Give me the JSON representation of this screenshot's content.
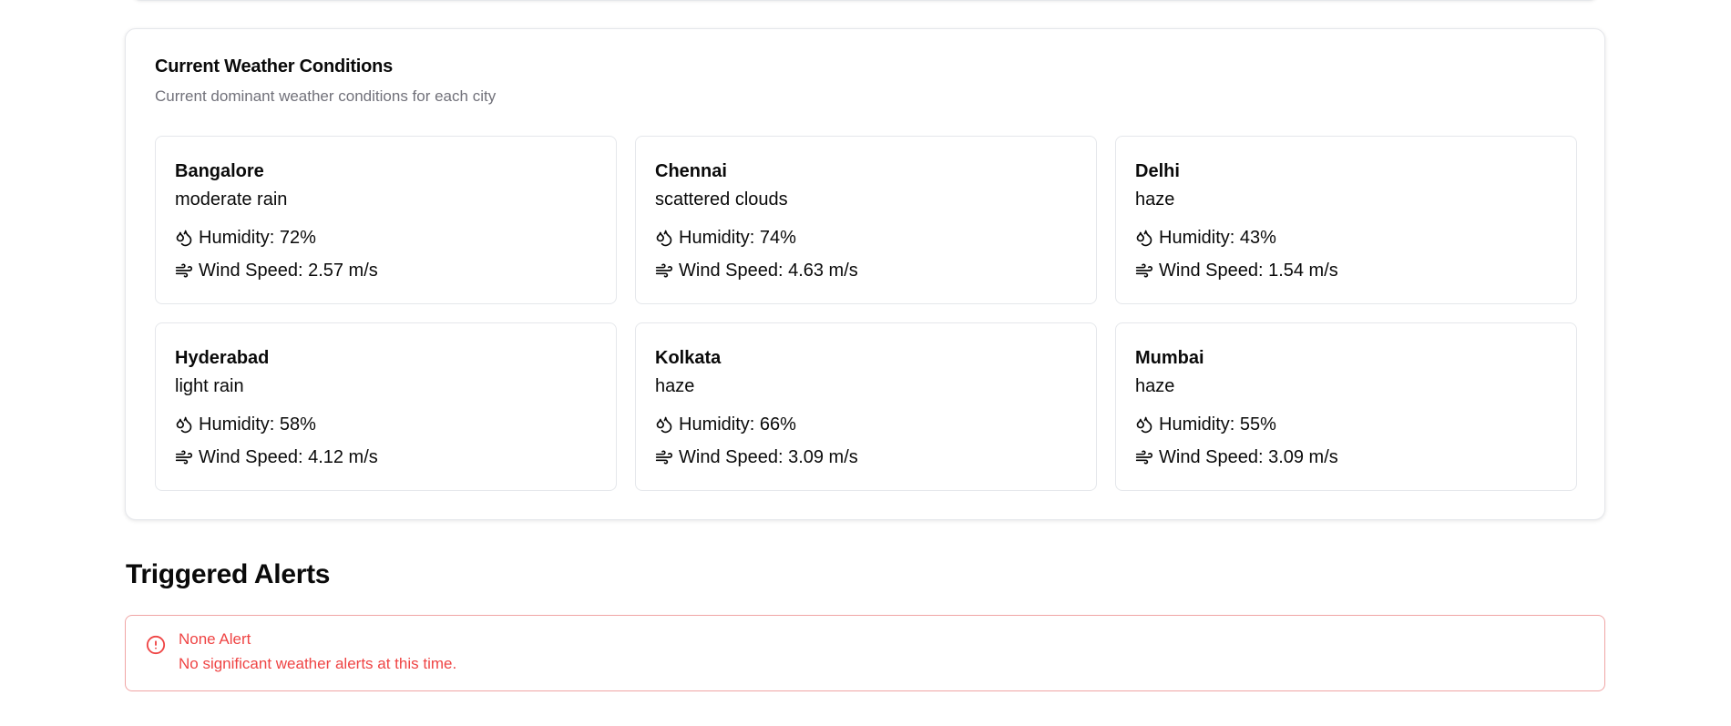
{
  "conditions": {
    "title": "Current Weather Conditions",
    "subtitle": "Current dominant weather conditions for each city",
    "cities": [
      {
        "name": "Bangalore",
        "condition": "moderate rain",
        "humidity": "Humidity: 72%",
        "wind": "Wind Speed: 2.57 m/s"
      },
      {
        "name": "Chennai",
        "condition": "scattered clouds",
        "humidity": "Humidity: 74%",
        "wind": "Wind Speed: 4.63 m/s"
      },
      {
        "name": "Delhi",
        "condition": "haze",
        "humidity": "Humidity: 43%",
        "wind": "Wind Speed: 1.54 m/s"
      },
      {
        "name": "Hyderabad",
        "condition": "light rain",
        "humidity": "Humidity: 58%",
        "wind": "Wind Speed: 4.12 m/s"
      },
      {
        "name": "Kolkata",
        "condition": "haze",
        "humidity": "Humidity: 66%",
        "wind": "Wind Speed: 3.09 m/s"
      },
      {
        "name": "Mumbai",
        "condition": "haze",
        "humidity": "Humidity: 55%",
        "wind": "Wind Speed: 3.09 m/s"
      }
    ],
    "humidity_icon": "droplets-icon",
    "wind_icon": "wind-icon"
  },
  "alerts": {
    "title": "Triggered Alerts",
    "items": [
      {
        "title": "None Alert",
        "description": "No significant weather alerts at this time.",
        "icon": "alert-circle-icon"
      }
    ],
    "color": "#ef4444"
  }
}
